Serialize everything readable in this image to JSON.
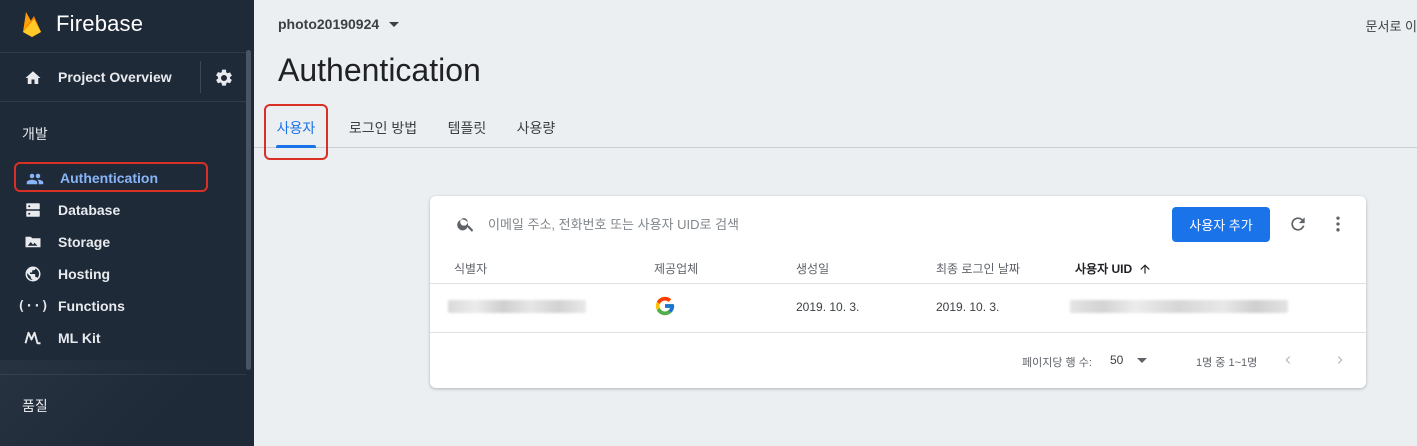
{
  "sidebar": {
    "brand": "Firebase",
    "overview": "Project Overview",
    "sections": {
      "develop": "개발",
      "quality": "품질"
    },
    "items": [
      {
        "label": "Authentication",
        "icon": "people-icon"
      },
      {
        "label": "Database",
        "icon": "database-icon"
      },
      {
        "label": "Storage",
        "icon": "storage-icon"
      },
      {
        "label": "Hosting",
        "icon": "hosting-icon"
      },
      {
        "label": "Functions",
        "icon": "functions-icon"
      },
      {
        "label": "ML Kit",
        "icon": "mlkit-icon"
      }
    ]
  },
  "header": {
    "project": "photo20190924",
    "docs_link": "문서로 이",
    "title": "Authentication",
    "tabs": [
      "사용자",
      "로그인 방법",
      "템플릿",
      "사용량"
    ]
  },
  "users": {
    "search_placeholder": "이메일 주소, 전화번호 또는 사용자 UID로 검색",
    "add_button": "사용자 추가",
    "columns": [
      "식별자",
      "제공업체",
      "생성일",
      "최종 로그인 날짜",
      "사용자 UID"
    ],
    "rows": [
      {
        "created": "2019. 10. 3.",
        "last_login": "2019. 10. 3.",
        "provider": "google"
      }
    ],
    "pager": {
      "rows_per_page_label": "페이지당 행 수:",
      "rows_per_page": "50",
      "range": "1명 중 1~1명"
    }
  },
  "colors": {
    "sidebar_bg": "#1e2a38",
    "accent": "#1a73e8",
    "highlight": "#d93025"
  }
}
